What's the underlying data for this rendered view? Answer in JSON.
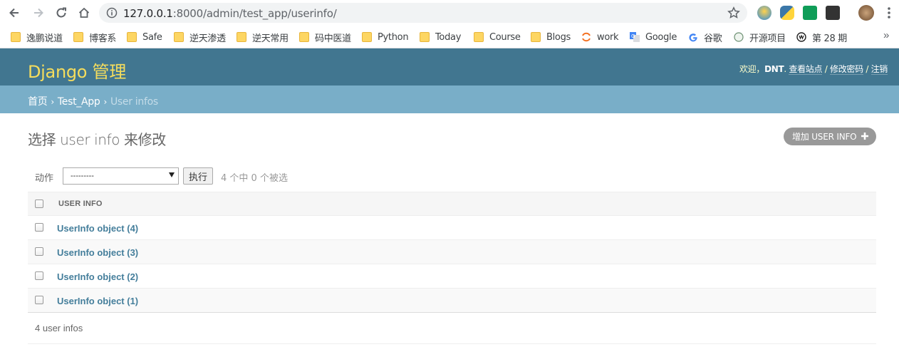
{
  "browser": {
    "url_host": "127.0.0.1",
    "url_rest": ":8000/admin/test_app/userinfo/",
    "bookmarks": [
      {
        "label": "逸鹏说道",
        "icon": "folder-icon"
      },
      {
        "label": "博客系",
        "icon": "folder-icon"
      },
      {
        "label": "Safe",
        "icon": "folder-icon"
      },
      {
        "label": "逆天渗透",
        "icon": "folder-icon"
      },
      {
        "label": "逆天常用",
        "icon": "folder-icon"
      },
      {
        "label": "码中医道",
        "icon": "folder-icon"
      },
      {
        "label": "Python",
        "icon": "folder-icon"
      },
      {
        "label": "Today",
        "icon": "folder-icon"
      },
      {
        "label": "Course",
        "icon": "folder-icon"
      },
      {
        "label": "Blogs",
        "icon": "folder-icon"
      },
      {
        "label": "work",
        "icon": "work-icon"
      },
      {
        "label": "Google",
        "icon": "google-translate-icon"
      },
      {
        "label": "谷歌",
        "icon": "google-icon"
      },
      {
        "label": "开源项目",
        "icon": "open-source-icon"
      },
      {
        "label": "第 28 期",
        "icon": "issue-icon"
      }
    ],
    "more": "»"
  },
  "header": {
    "branding": "Django 管理",
    "welcome": "欢迎，",
    "username": "DNT",
    "dot": ". ",
    "view_site": "查看站点",
    "change_password": "修改密码",
    "logout": "注销",
    "sep": " / "
  },
  "breadcrumbs": {
    "home": "首页",
    "app": "Test_App",
    "current": "User infos",
    "sep": "›"
  },
  "content": {
    "title": "选择 user info 来修改",
    "add_button": "增加 USER INFO",
    "actions": {
      "label": "动作",
      "select_value": "---------",
      "go_label": "执行",
      "counter": "4 个中 0 个被选"
    },
    "table": {
      "column": "USER INFO",
      "rows": [
        "UserInfo object (4)",
        "UserInfo object (3)",
        "UserInfo object (2)",
        "UserInfo object (1)"
      ]
    },
    "paginator": "4 user infos"
  },
  "colors": {
    "header_bg": "#417690",
    "breadcrumb_bg": "#79aec8",
    "branding": "#f5dd5d",
    "link": "#447e9b"
  }
}
